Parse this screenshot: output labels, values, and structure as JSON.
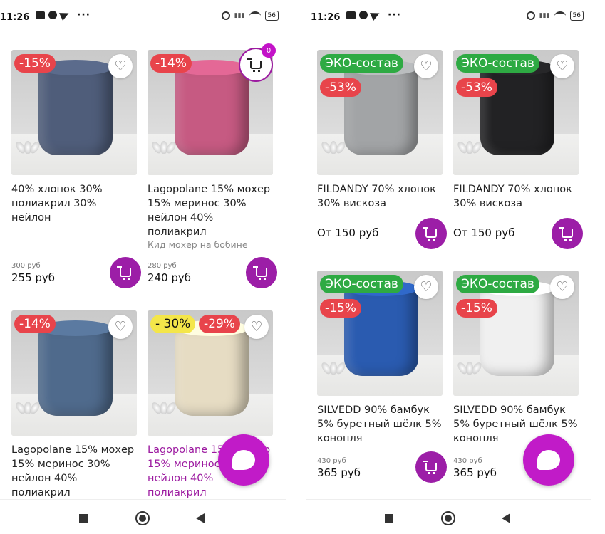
{
  "status_left": {
    "time": "11:26",
    "icons": [
      "message-icon",
      "circle-app-icon",
      "telegram-icon",
      "more-dots-icon"
    ],
    "dots": "···"
  },
  "status_right": {
    "time": "11:26",
    "icons": [
      "message-icon",
      "circle-app-icon",
      "telegram-icon",
      "more-dots-icon"
    ],
    "dots": "···"
  },
  "status_common": {
    "battery": "56",
    "icons": [
      "alarm-icon",
      "signal-icon",
      "wifi-icon",
      "battery-icon"
    ]
  },
  "left": {
    "cart_count": "0",
    "products": [
      {
        "badges": [
          "-15%"
        ],
        "title": "40% хлопок 30% полиакрил 30% нейлон",
        "subtitle": "",
        "old_price": "300 руб",
        "price": "255 руб",
        "yarn_color": "#4f5d7a"
      },
      {
        "badges": [
          "-14%"
        ],
        "title": "Lagopolane 15% мохер 15% меринос 30% нейлон 40% полиакрил",
        "subtitle": "Кид мохер на бобине",
        "old_price": "280 руб",
        "price": "240 руб",
        "yarn_color": "#c65a82"
      },
      {
        "badges": [
          "-14%"
        ],
        "title": "Lagopolane 15% мохер 15% меринос 30% нейлон 40% полиакрил",
        "subtitle": "",
        "yarn_color": "#4f6a8c"
      },
      {
        "badges": [
          "- 30%",
          "-29%"
        ],
        "title": "Lagopolane 15% мохер 15% меринос 30% нейлон 40% полиакрил",
        "subtitle": "",
        "yarn_color": "#e6dcc3"
      }
    ]
  },
  "right": {
    "products": [
      {
        "eco": "ЭКО-состав",
        "badge": "-53%",
        "title": "FILDANDY 70% хлопок 30% вискоза",
        "from_price": "От 150 руб",
        "yarn_color": "#a2a4a6"
      },
      {
        "eco": "ЭКО-состав",
        "badge": "-53%",
        "title": "FILDANDY 70% хлопок 30% вискоза",
        "from_price": "От 150 руб",
        "yarn_color": "#222224"
      },
      {
        "eco": "ЭКО-состав",
        "badge": "-15%",
        "title": "SILVEDD 90% бамбук 5% буретный шёлк 5% конопля",
        "old_price": "430 руб",
        "price": "365 руб",
        "yarn_color": "#2a5bb0"
      },
      {
        "eco": "ЭКО-состав",
        "badge": "-15%",
        "title": "SILVEDD 90% бамбук 5% буретный шёлк 5% конопля",
        "old_price": "430 руб",
        "price": "365 руб",
        "yarn_color": "#f0f0f0"
      }
    ]
  },
  "colors": {
    "accent": "#9c1ea7",
    "chat_fab": "#c11bc8",
    "discount": "#e8444b",
    "eco": "#2eaa43",
    "yellow_badge": "#f4e64a"
  },
  "nav": {
    "icons": [
      "recent-apps-icon",
      "home-icon",
      "back-icon"
    ]
  }
}
